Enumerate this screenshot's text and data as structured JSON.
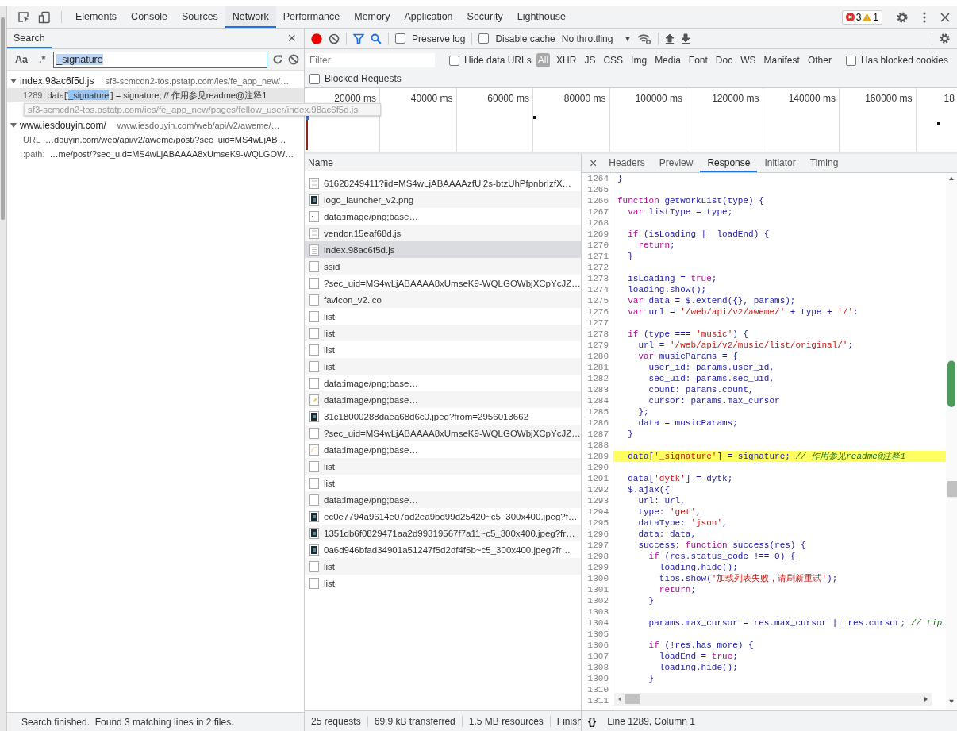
{
  "devtools_tabs": [
    {
      "label": "Elements",
      "selected": false
    },
    {
      "label": "Console",
      "selected": false
    },
    {
      "label": "Sources",
      "selected": false
    },
    {
      "label": "Network",
      "selected": true
    },
    {
      "label": "Performance",
      "selected": false
    },
    {
      "label": "Memory",
      "selected": false
    },
    {
      "label": "Application",
      "selected": false
    },
    {
      "label": "Security",
      "selected": false
    },
    {
      "label": "Lighthouse",
      "selected": false
    }
  ],
  "issues": {
    "errors": "3",
    "warnings": "1"
  },
  "search_panel": {
    "title": "Search",
    "close_label": "×",
    "case_label": "Aa",
    "regex_label": ".*",
    "query": "_signature",
    "results": [
      {
        "file": "index.98ac6f5d.js",
        "location": "sf3-scmcdn2-tos.pstatp.com/ies/fe_app_new/…",
        "expanded": true,
        "matches": [
          {
            "line": "1289",
            "before": "data['",
            "match": "_signature",
            "after": "'] = signature; // 作用参见readme@注释1"
          }
        ]
      },
      {
        "file": "www.iesdouyin.com/",
        "location": "www.iesdouyin.com/web/api/v2/aweme/…",
        "expanded": true,
        "matches": [
          {
            "line": "URL",
            "before": "…douyin.com/web/api/v2/aweme/post/?sec_uid=MS4wLjAB…"
          },
          {
            "line": ":path:",
            "before": "…me/post/?sec_uid=MS4wLjABAAAA8xUmseK9-WQLGOW…"
          }
        ]
      }
    ],
    "tooltip": "sf3-scmcdn2-tos.pstatp.com/ies/fe_app_new/pages/fellow_user/index.98ac6f5d.js",
    "status": "Search finished.  Found 3 matching lines in 2 files."
  },
  "network_toolbar": {
    "recording": true,
    "filter_shown": true,
    "preserve_log": false,
    "preserve_log_label": "Preserve log",
    "disable_cache": false,
    "disable_cache_label": "Disable cache",
    "throttling": "No throttling",
    "dropdown_arrow": "▼"
  },
  "filter_bar": {
    "placeholder": "Filter",
    "hide_data_urls": false,
    "hide_data_urls_label": "Hide data URLs",
    "types": [
      {
        "label": "All",
        "selected": true
      },
      {
        "label": "XHR",
        "selected": false
      },
      {
        "label": "JS",
        "selected": false
      },
      {
        "label": "CSS",
        "selected": false
      },
      {
        "label": "Img",
        "selected": false
      },
      {
        "label": "Media",
        "selected": false
      },
      {
        "label": "Font",
        "selected": false
      },
      {
        "label": "Doc",
        "selected": false
      },
      {
        "label": "WS",
        "selected": false
      },
      {
        "label": "Manifest",
        "selected": false
      },
      {
        "label": "Other",
        "selected": false
      }
    ],
    "has_blocked_cookies": false,
    "has_blocked_cookies_label": "Has blocked cookies",
    "blocked_requests": false,
    "blocked_requests_label": "Blocked Requests"
  },
  "overview": {
    "ticks": [
      "20000 ms",
      "40000 ms",
      "60000 ms",
      "80000 ms",
      "100000 ms",
      "120000 ms",
      "140000 ms",
      "160000 ms",
      "18"
    ]
  },
  "requests": {
    "column": "Name",
    "rows": [
      {
        "name": "61628249411?iid=MS4wLjABAAAAzfUi2s-btzUhPfpnbrIzfX…",
        "kind": "document",
        "selected": false
      },
      {
        "name": "logo_launcher_v2.png",
        "kind": "dark-thumbnail",
        "selected": false
      },
      {
        "name": "data:image/png;base…",
        "kind": "dot",
        "selected": false
      },
      {
        "name": "vendor.15eaf68d.js",
        "kind": "document",
        "selected": false
      },
      {
        "name": "index.98ac6f5d.js",
        "kind": "document",
        "selected": true
      },
      {
        "name": "ssid",
        "kind": "blank",
        "selected": false
      },
      {
        "name": "?sec_uid=MS4wLjABAAAA8xUmseK9-WQLGOWbjXCpYcJZ…",
        "kind": "blank",
        "selected": false
      },
      {
        "name": "favicon_v2.ico",
        "kind": "blank",
        "selected": false
      },
      {
        "name": "list",
        "kind": "blank",
        "selected": false
      },
      {
        "name": "list",
        "kind": "blank",
        "selected": false
      },
      {
        "name": "list",
        "kind": "blank",
        "selected": false
      },
      {
        "name": "list",
        "kind": "blank",
        "selected": false
      },
      {
        "name": "data:image/png;base…",
        "kind": "blank",
        "selected": false
      },
      {
        "name": "data:image/png;base…",
        "kind": "yellow-thumbnail",
        "selected": false
      },
      {
        "name": "31c18000288daea68d6c0.jpeg?from=2956013662",
        "kind": "dark-thumbnail",
        "selected": false
      },
      {
        "name": "?sec_uid=MS4wLjABAAAA8xUmseK9-WQLGOWbjXCpYcJZ…",
        "kind": "blank",
        "selected": false
      },
      {
        "name": "data:image/png;base…",
        "kind": "pale-thumbnail",
        "selected": false
      },
      {
        "name": "list",
        "kind": "blank",
        "selected": false
      },
      {
        "name": "list",
        "kind": "blank",
        "selected": false
      },
      {
        "name": "data:image/png;base…",
        "kind": "blank",
        "selected": false
      },
      {
        "name": "ec0e7794a9614e07ad2ea9bd99d25420~c5_300x400.jpeg?f…",
        "kind": "dark-thumbnail",
        "selected": false
      },
      {
        "name": "1351db6f0829471aa2d99319567f7a11~c5_300x400.jpeg?fr…",
        "kind": "dark-thumbnail",
        "selected": false
      },
      {
        "name": "0a6d946bfad34901a51247f5d2df4f5b~c5_300x400.jpeg?fr…",
        "kind": "dark-thumbnail",
        "selected": false
      },
      {
        "name": "list",
        "kind": "blank",
        "selected": false
      },
      {
        "name": "list",
        "kind": "blank",
        "selected": false
      }
    ]
  },
  "summary": [
    "25 requests",
    "69.9 kB transferred",
    "1.5 MB resources",
    "Finish"
  ],
  "details": {
    "close_label": "×",
    "tabs": [
      {
        "label": "Headers",
        "selected": false
      },
      {
        "label": "Preview",
        "selected": false
      },
      {
        "label": "Response",
        "selected": true
      },
      {
        "label": "Initiator",
        "selected": false
      },
      {
        "label": "Timing",
        "selected": false
      }
    ],
    "lines": [
      {
        "number": "1264",
        "highlighted": false,
        "tokens": [
          {
            "kind": "name",
            "text": "}"
          }
        ]
      },
      {
        "number": "1265",
        "highlighted": false
      },
      {
        "number": "1266",
        "highlighted": false,
        "tokens": [
          {
            "kind": "keyword",
            "text": "function"
          },
          {
            "kind": "name",
            "text": " getWorkList(type) {"
          }
        ]
      },
      {
        "number": "1267",
        "highlighted": false,
        "tokens": [
          {
            "kind": "keyword",
            "text": "  var"
          },
          {
            "kind": "name",
            "text": " listType = type;"
          }
        ]
      },
      {
        "number": "1268",
        "highlighted": false
      },
      {
        "number": "1269",
        "highlighted": false,
        "tokens": [
          {
            "kind": "keyword",
            "text": "  if"
          },
          {
            "kind": "name",
            "text": " (isLoading || loadEnd) {"
          }
        ]
      },
      {
        "number": "1270",
        "highlighted": false,
        "tokens": [
          {
            "kind": "keyword",
            "text": "    return"
          },
          {
            "kind": "name",
            "text": ";"
          }
        ]
      },
      {
        "number": "1271",
        "highlighted": false,
        "tokens": [
          {
            "kind": "name",
            "text": "  }"
          }
        ]
      },
      {
        "number": "1272",
        "highlighted": false
      },
      {
        "number": "1273",
        "highlighted": false,
        "tokens": [
          {
            "kind": "name",
            "text": "  isLoading = "
          },
          {
            "kind": "keyword",
            "text": "true"
          },
          {
            "kind": "name",
            "text": ";"
          }
        ]
      },
      {
        "number": "1274",
        "highlighted": false,
        "tokens": [
          {
            "kind": "name",
            "text": "  loading.show();"
          }
        ]
      },
      {
        "number": "1275",
        "highlighted": false,
        "tokens": [
          {
            "kind": "keyword",
            "text": "  var"
          },
          {
            "kind": "name",
            "text": " data = $.extend({}, params);"
          }
        ]
      },
      {
        "number": "1276",
        "highlighted": false,
        "tokens": [
          {
            "kind": "keyword",
            "text": "  var"
          },
          {
            "kind": "name",
            "text": " url = "
          },
          {
            "kind": "string",
            "text": "'/web/api/v2/aweme/'"
          },
          {
            "kind": "name",
            "text": " + type + "
          },
          {
            "kind": "string",
            "text": "'/'"
          },
          {
            "kind": "name",
            "text": ";"
          }
        ]
      },
      {
        "number": "1277",
        "highlighted": false
      },
      {
        "number": "1278",
        "highlighted": false,
        "tokens": [
          {
            "kind": "keyword",
            "text": "  if"
          },
          {
            "kind": "name",
            "text": " (type === "
          },
          {
            "kind": "string",
            "text": "'music'"
          },
          {
            "kind": "name",
            "text": ") {"
          }
        ]
      },
      {
        "number": "1279",
        "highlighted": false,
        "tokens": [
          {
            "kind": "name",
            "text": "    url = "
          },
          {
            "kind": "string",
            "text": "'/web/api/v2/music/list/original/'"
          },
          {
            "kind": "name",
            "text": ";"
          }
        ]
      },
      {
        "number": "1280",
        "highlighted": false,
        "tokens": [
          {
            "kind": "keyword",
            "text": "    var"
          },
          {
            "kind": "name",
            "text": " musicParams = {"
          }
        ]
      },
      {
        "number": "1281",
        "highlighted": false,
        "tokens": [
          {
            "kind": "name",
            "text": "      user_id: params.user_id,"
          }
        ]
      },
      {
        "number": "1282",
        "highlighted": false,
        "tokens": [
          {
            "kind": "name",
            "text": "      sec_uid: params.sec_uid,"
          }
        ]
      },
      {
        "number": "1283",
        "highlighted": false,
        "tokens": [
          {
            "kind": "name",
            "text": "      count: params.count,"
          }
        ]
      },
      {
        "number": "1284",
        "highlighted": false,
        "tokens": [
          {
            "kind": "name",
            "text": "      cursor: params.max_cursor"
          }
        ]
      },
      {
        "number": "1285",
        "highlighted": false,
        "tokens": [
          {
            "kind": "name",
            "text": "    };"
          }
        ]
      },
      {
        "number": "1286",
        "highlighted": false,
        "tokens": [
          {
            "kind": "name",
            "text": "    data = musicParams;"
          }
        ]
      },
      {
        "number": "1287",
        "highlighted": false,
        "tokens": [
          {
            "kind": "name",
            "text": "  }"
          }
        ]
      },
      {
        "number": "1288",
        "highlighted": false
      },
      {
        "number": "1289",
        "highlighted": true,
        "tokens": [
          {
            "kind": "name",
            "text": "  data["
          },
          {
            "kind": "string",
            "text": "'_signature'"
          },
          {
            "kind": "name",
            "text": "] = signature; "
          },
          {
            "kind": "comment",
            "text": "// 作用参见readme@注释1"
          }
        ]
      },
      {
        "number": "1290",
        "highlighted": false
      },
      {
        "number": "1291",
        "highlighted": false,
        "tokens": [
          {
            "kind": "name",
            "text": "  data["
          },
          {
            "kind": "string",
            "text": "'dytk'"
          },
          {
            "kind": "name",
            "text": "] = dytk;"
          }
        ]
      },
      {
        "number": "1292",
        "highlighted": false,
        "tokens": [
          {
            "kind": "name",
            "text": "  $.ajax({"
          }
        ]
      },
      {
        "number": "1293",
        "highlighted": false,
        "tokens": [
          {
            "kind": "name",
            "text": "    url: url,"
          }
        ]
      },
      {
        "number": "1294",
        "highlighted": false,
        "tokens": [
          {
            "kind": "name",
            "text": "    type: "
          },
          {
            "kind": "string",
            "text": "'get'"
          },
          {
            "kind": "name",
            "text": ","
          }
        ]
      },
      {
        "number": "1295",
        "highlighted": false,
        "tokens": [
          {
            "kind": "name",
            "text": "    dataType: "
          },
          {
            "kind": "string",
            "text": "'json'"
          },
          {
            "kind": "name",
            "text": ","
          }
        ]
      },
      {
        "number": "1296",
        "highlighted": false,
        "tokens": [
          {
            "kind": "name",
            "text": "    data: data,"
          }
        ]
      },
      {
        "number": "1297",
        "highlighted": false,
        "tokens": [
          {
            "kind": "name",
            "text": "    success: "
          },
          {
            "kind": "keyword",
            "text": "function"
          },
          {
            "kind": "name",
            "text": " success(res) {"
          }
        ]
      },
      {
        "number": "1298",
        "highlighted": false,
        "tokens": [
          {
            "kind": "keyword",
            "text": "      if"
          },
          {
            "kind": "name",
            "text": " (res.status_code !== "
          },
          {
            "kind": "number",
            "text": "0"
          },
          {
            "kind": "name",
            "text": ") {"
          }
        ]
      },
      {
        "number": "1299",
        "highlighted": false,
        "tokens": [
          {
            "kind": "name",
            "text": "        loading.hide();"
          }
        ]
      },
      {
        "number": "1300",
        "highlighted": false,
        "tokens": [
          {
            "kind": "name",
            "text": "        tips.show("
          },
          {
            "kind": "string",
            "text": "'加载列表失败，请刷新重试'"
          },
          {
            "kind": "name",
            "text": ");"
          }
        ]
      },
      {
        "number": "1301",
        "highlighted": false,
        "tokens": [
          {
            "kind": "keyword",
            "text": "        return"
          },
          {
            "kind": "name",
            "text": ";"
          }
        ]
      },
      {
        "number": "1302",
        "highlighted": false,
        "tokens": [
          {
            "kind": "name",
            "text": "      }"
          }
        ]
      },
      {
        "number": "1303",
        "highlighted": false
      },
      {
        "number": "1304",
        "highlighted": false,
        "tokens": [
          {
            "kind": "name",
            "text": "      params.max_cursor = res.max_cursor || res.cursor; "
          },
          {
            "kind": "comment",
            "text": "// tip"
          }
        ]
      },
      {
        "number": "1305",
        "highlighted": false
      },
      {
        "number": "1306",
        "highlighted": false,
        "tokens": [
          {
            "kind": "keyword",
            "text": "      if"
          },
          {
            "kind": "name",
            "text": " (!res.has_more) {"
          }
        ]
      },
      {
        "number": "1307",
        "highlighted": false,
        "tokens": [
          {
            "kind": "name",
            "text": "        loadEnd = "
          },
          {
            "kind": "keyword",
            "text": "true"
          },
          {
            "kind": "name",
            "text": ";"
          }
        ]
      },
      {
        "number": "1308",
        "highlighted": false,
        "tokens": [
          {
            "kind": "name",
            "text": "        loading.hide();"
          }
        ]
      },
      {
        "number": "1309",
        "highlighted": false,
        "tokens": [
          {
            "kind": "name",
            "text": "      }"
          }
        ]
      },
      {
        "number": "1310",
        "highlighted": false
      },
      {
        "number": "1311",
        "highlighted": false
      }
    ],
    "format_label": "{}",
    "cursor_position": "Line 1289, Column 1"
  }
}
